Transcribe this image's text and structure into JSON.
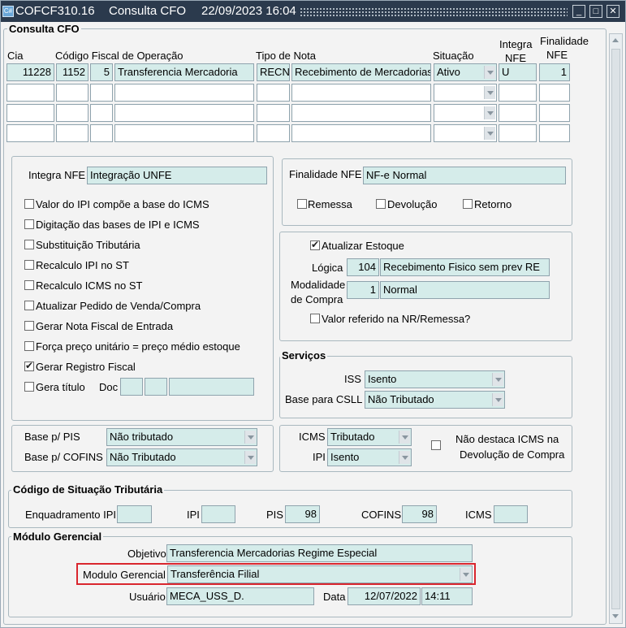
{
  "titlebar": {
    "app_code": "COFCF310.16",
    "screen": "Consulta CFO",
    "datetime": "22/09/2023 16:04",
    "icon_text": "C#"
  },
  "form_title": "Consulta CFO",
  "grid": {
    "headers": {
      "cia": "Cia",
      "codigo_fiscal": "Código Fiscal de Operação",
      "tipo_nota": "Tipo de Nota",
      "situacao": "Situação",
      "integra_nfe_1": "Integra",
      "integra_nfe_2": "NFE",
      "finalidade_nfe_1": "Finalidade",
      "finalidade_nfe_2": "NFE"
    },
    "row1": {
      "cia": "11228",
      "codigo": "1152",
      "seq": "5",
      "descricao": "Transferencia Mercadoria",
      "tipo": "RECN",
      "tipo_desc": "Recebimento de Mercadorias",
      "situacao": "Ativo",
      "integra": "U",
      "finalidade": "1"
    }
  },
  "left_panel": {
    "integra_nfe_label": "Integra NFE",
    "integra_nfe_value": "Integração UNFE",
    "checkboxes": [
      {
        "label": "Valor do IPI compõe a base do ICMS",
        "checked": false
      },
      {
        "label": "Digitação das bases de IPI e ICMS",
        "checked": false
      },
      {
        "label": "Substituição Tributária",
        "checked": false
      },
      {
        "label": "Recalculo IPI no ST",
        "checked": false
      },
      {
        "label": "Recalculo ICMS no ST",
        "checked": false
      },
      {
        "label": "Atualizar Pedido de Venda/Compra",
        "checked": false
      },
      {
        "label": "Gerar Nota Fiscal de Entrada",
        "checked": false
      },
      {
        "label": "Força preço unitário = preço médio estoque",
        "checked": false
      },
      {
        "label": "Gerar Registro Fiscal",
        "checked": true
      },
      {
        "label": "Gera título",
        "checked": false
      }
    ],
    "doc_label": "Doc"
  },
  "finalidade_panel": {
    "label": "Finalidade NFE",
    "value": "NF-e Normal",
    "remessa": "Remessa",
    "devolucao": "Devolução",
    "retorno": "Retorno"
  },
  "estoque_panel": {
    "atualizar_estoque": "Atualizar Estoque",
    "logica_label": "Lógica",
    "logica_code": "104",
    "logica_desc": "Recebimento Fisico sem prev RE",
    "modalidade_label_1": "Modalidade",
    "modalidade_label_2": "de Compra",
    "modalidade_code": "1",
    "modalidade_desc": "Normal",
    "valor_referido": "Valor referido na NR/Remessa?"
  },
  "servicos": {
    "title": "Serviços",
    "iss_label": "ISS",
    "iss_value": "Isento",
    "csll_label": "Base para CSLL",
    "csll_value": "Não Tributado"
  },
  "pis_cofins": {
    "pis_label": "Base p/ PIS",
    "pis_value": "Não tributado",
    "cofins_label": "Base p/ COFINS",
    "cofins_value": "Não Tributado"
  },
  "icms_ipi": {
    "icms_label": "ICMS",
    "icms_value": "Tributado",
    "ipi_label": "IPI",
    "ipi_value": "Isento",
    "nao_destaca_1": "Não destaca ICMS na",
    "nao_destaca_2": "Devolução de Compra"
  },
  "cst": {
    "title": "Código de Situação Tributária",
    "enquadramento_label": "Enquadramento IPI",
    "ipi_label": "IPI",
    "pis_label": "PIS",
    "pis_value": "98",
    "cofins_label": "COFINS",
    "cofins_value": "98",
    "icms_label": "ICMS"
  },
  "modulo": {
    "title": "Módulo Gerencial",
    "objetivo_label": "Objetivo",
    "objetivo_value": "Transferencia Mercadorias Regime Especial",
    "modulo_label": "Modulo Gerencial",
    "modulo_value": "Transferência Filial",
    "usuario_label": "Usuário",
    "usuario_value": "MECA_USS_D.",
    "data_label": "Data",
    "data_value": "12/07/2022",
    "hora_value": "14:11"
  },
  "colors": {
    "titlebar": "#2b3a4d",
    "field_bg": "#d5ecea",
    "highlight": "#d9262e"
  }
}
